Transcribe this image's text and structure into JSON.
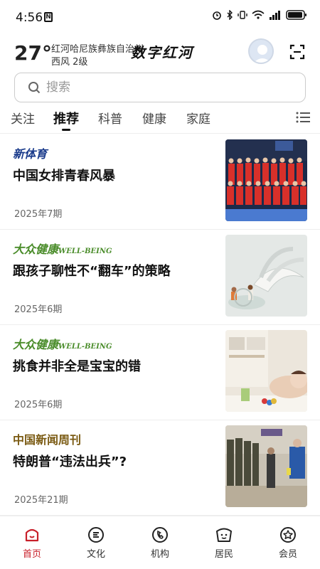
{
  "status": {
    "time": "4:56",
    "nfc_glyph": "N",
    "icons": [
      "alarm-icon",
      "bluetooth-icon",
      "vibrate-icon",
      "wifi-icon",
      "signal-icon",
      "battery-icon"
    ]
  },
  "header": {
    "temperature": "27°",
    "location": "红河哈尼族彝族自治州",
    "wind": "西风  2级",
    "logo_text": "数字红河"
  },
  "search": {
    "placeholder": "搜索"
  },
  "tabs": [
    {
      "label": "关注",
      "active": false
    },
    {
      "label": "推荐",
      "active": true
    },
    {
      "label": "科普",
      "active": false
    },
    {
      "label": "健康",
      "active": false
    },
    {
      "label": "家庭",
      "active": false
    }
  ],
  "feed": [
    {
      "publication": "新体育",
      "title": "中国女排青春风暴",
      "issue": "2025年7期"
    },
    {
      "publication": "大众健康",
      "publication_sub": "WELL-BEING",
      "title": "跟孩子聊性不“翻车”的策略",
      "issue": "2025年6期"
    },
    {
      "publication": "大众健康",
      "publication_sub": "WELL-BEING",
      "title": "挑食并非全是宝宝的错",
      "issue": "2025年6期"
    },
    {
      "publication": "中国新闻周刊",
      "title": "特朗普“违法出兵”?",
      "issue": "2025年21期"
    }
  ],
  "bottom_nav": [
    {
      "label": "首页",
      "icon": "home-icon",
      "active": true
    },
    {
      "label": "文化",
      "icon": "culture-icon",
      "active": false
    },
    {
      "label": "机构",
      "icon": "institution-icon",
      "active": false
    },
    {
      "label": "居民",
      "icon": "residents-icon",
      "active": false
    },
    {
      "label": "会员",
      "icon": "member-icon",
      "active": false
    }
  ],
  "colors": {
    "accent": "#c8202a",
    "sports_brand": "#1b3c8c",
    "health_brand": "#4a8c2a",
    "news_brand": "#7a5a12"
  }
}
